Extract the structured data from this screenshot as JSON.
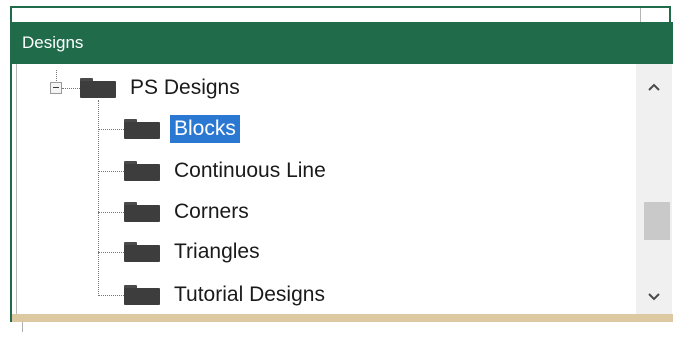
{
  "panel": {
    "title": "Designs",
    "accent_color": "#1f6b4a",
    "selection_color": "#2a78d2"
  },
  "tree": {
    "root": {
      "label": "PS Designs",
      "expanded": true,
      "icon": "folder-icon"
    },
    "children": [
      {
        "label": "Blocks",
        "selected": true,
        "icon": "folder-icon"
      },
      {
        "label": "Continuous Line",
        "selected": false,
        "icon": "folder-icon"
      },
      {
        "label": "Corners",
        "selected": false,
        "icon": "folder-icon"
      },
      {
        "label": "Triangles",
        "selected": false,
        "icon": "folder-icon"
      },
      {
        "label": "Tutorial Designs",
        "selected": false,
        "icon": "folder-icon"
      }
    ]
  },
  "scrollbar": {
    "up_glyph": "^",
    "down_glyph": "v"
  }
}
